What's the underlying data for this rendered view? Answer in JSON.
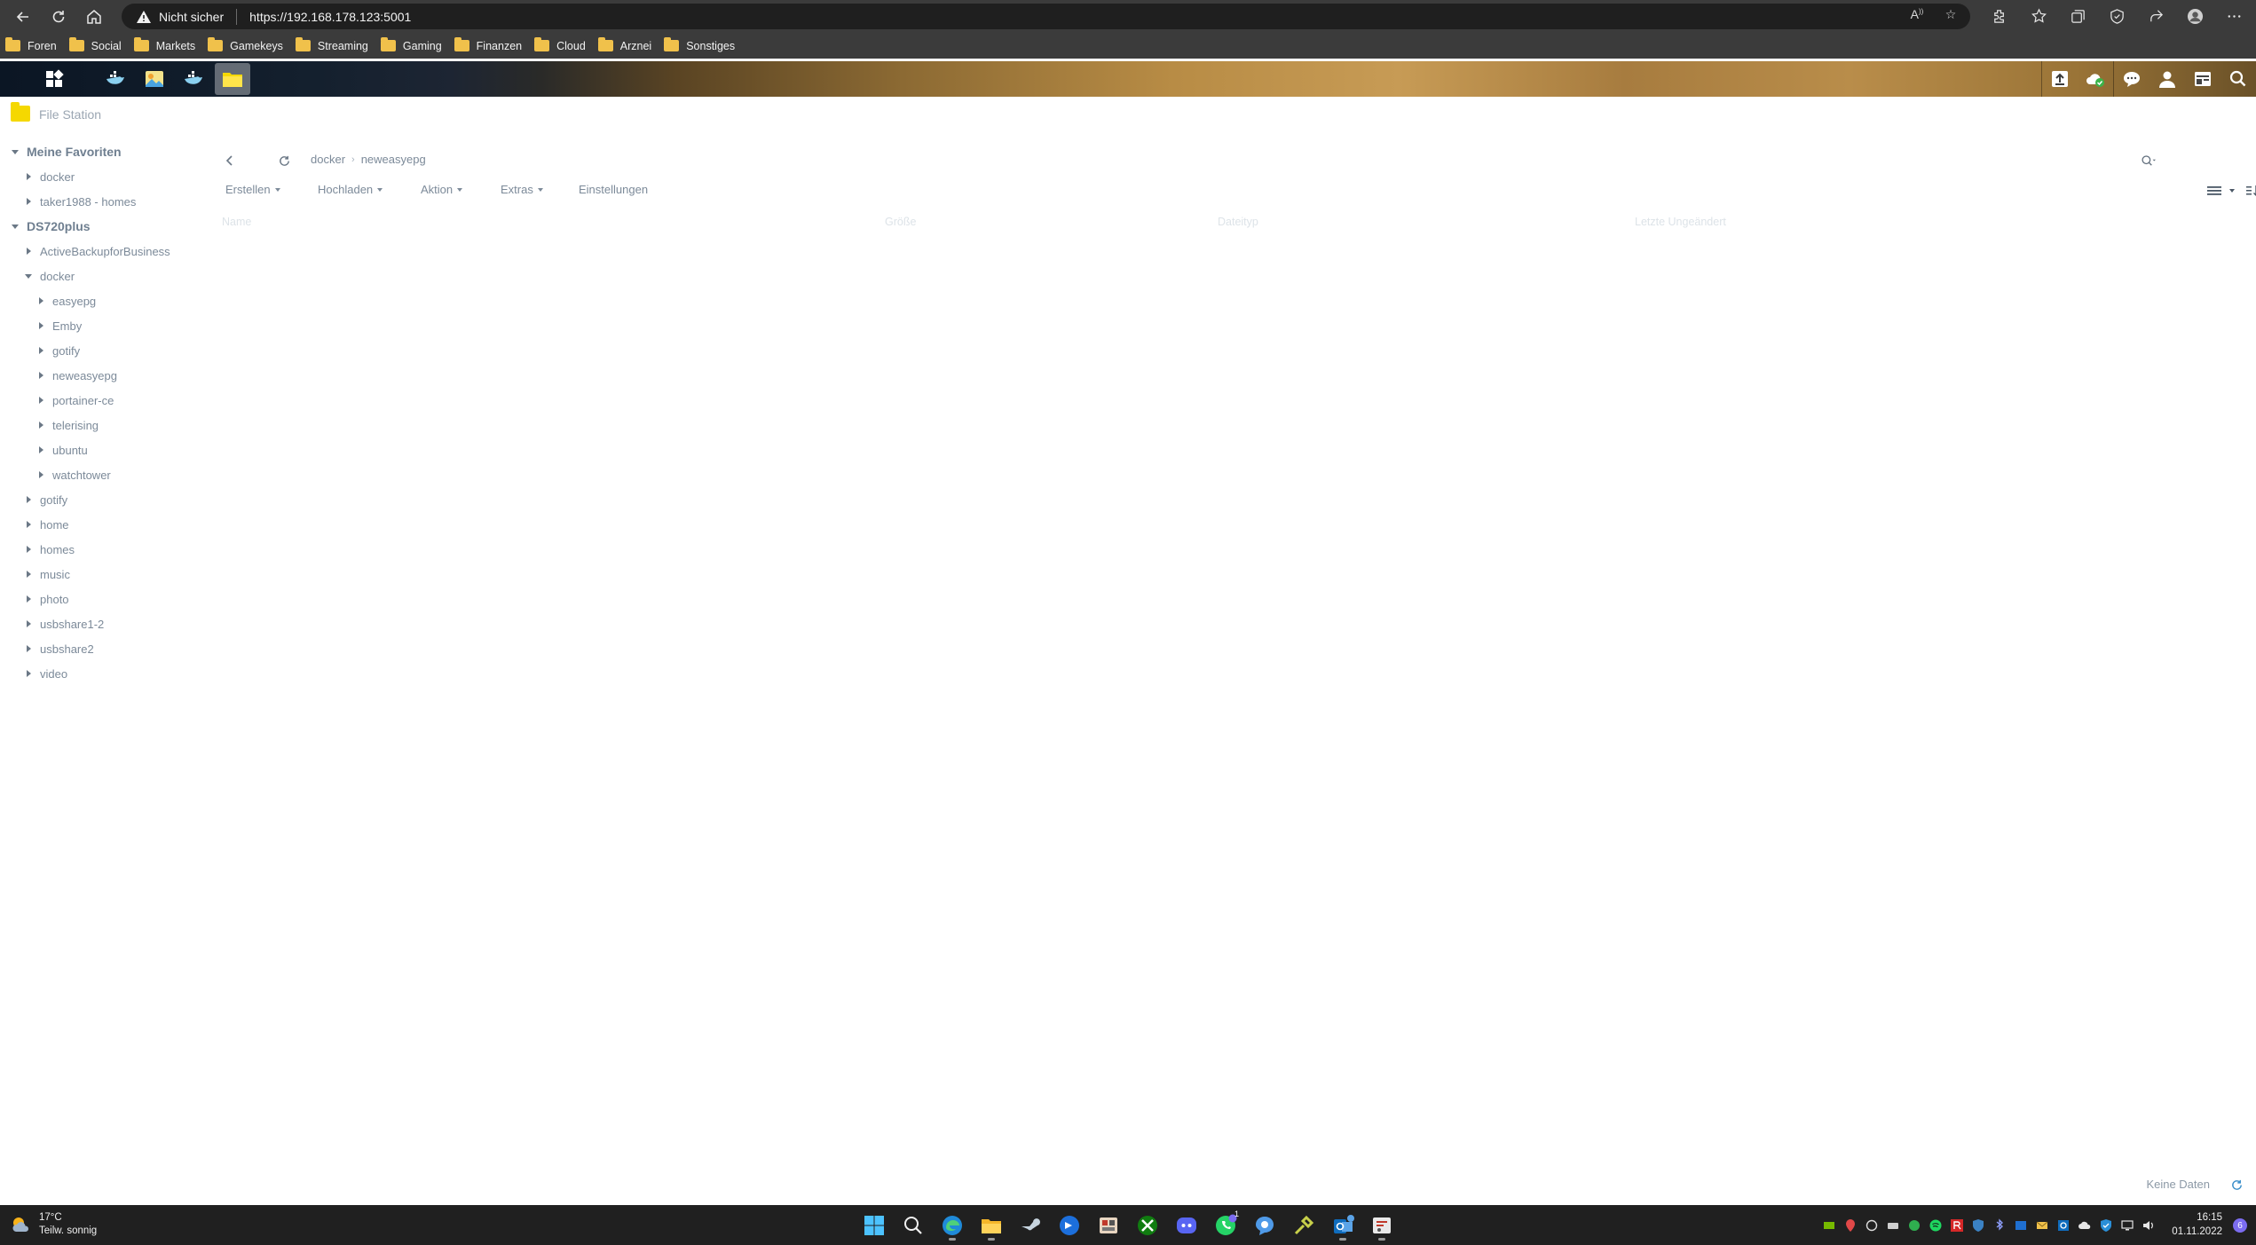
{
  "browser": {
    "security_label": "Nicht sicher",
    "url": "https://192.168.178.123:5001",
    "bookmarks": [
      "Foren",
      "Social",
      "Markets",
      "Gamekeys",
      "Streaming",
      "Gaming",
      "Finanzen",
      "Cloud",
      "Arznei",
      "Sonstiges"
    ]
  },
  "colors": {
    "browser_chrome": "#3b3b3b",
    "address_bar": "#1f1f1f",
    "folder_yellow": "#f0c14b",
    "fs_folder": "#f5d800",
    "sidebar_text": "#7c8a99",
    "windows_taskbar": "#202020"
  },
  "file_station": {
    "title": "File Station",
    "tree": [
      {
        "label": "Meine Favoriten",
        "level": 0,
        "expanded": true,
        "root": true
      },
      {
        "label": "docker",
        "level": 1,
        "expanded": false
      },
      {
        "label": "taker1988 - homes",
        "level": 1,
        "expanded": false
      },
      {
        "label": "DS720plus",
        "level": 0,
        "expanded": true,
        "root": true
      },
      {
        "label": "ActiveBackupforBusiness",
        "level": 1,
        "expanded": false
      },
      {
        "label": "docker",
        "level": 1,
        "expanded": true
      },
      {
        "label": "easyepg",
        "level": 2,
        "expanded": false
      },
      {
        "label": "Emby",
        "level": 2,
        "expanded": false
      },
      {
        "label": "gotify",
        "level": 2,
        "expanded": false
      },
      {
        "label": "neweasyepg",
        "level": 2,
        "expanded": false
      },
      {
        "label": "portainer-ce",
        "level": 2,
        "expanded": false
      },
      {
        "label": "telerising",
        "level": 2,
        "expanded": false
      },
      {
        "label": "ubuntu",
        "level": 2,
        "expanded": false
      },
      {
        "label": "watchtower",
        "level": 2,
        "expanded": false
      },
      {
        "label": "gotify",
        "level": 1,
        "expanded": false
      },
      {
        "label": "home",
        "level": 1,
        "expanded": false
      },
      {
        "label": "homes",
        "level": 1,
        "expanded": false
      },
      {
        "label": "music",
        "level": 1,
        "expanded": false
      },
      {
        "label": "photo",
        "level": 1,
        "expanded": false
      },
      {
        "label": "usbshare1-2",
        "level": 1,
        "expanded": false
      },
      {
        "label": "usbshare2",
        "level": 1,
        "expanded": false
      },
      {
        "label": "video",
        "level": 1,
        "expanded": false
      }
    ],
    "path": [
      "docker",
      "neweasyepg"
    ],
    "path_separator": "›",
    "toolbar": {
      "create": "Erstellen",
      "upload": "Hochladen",
      "action": "Aktion",
      "extras": "Extras",
      "settings": "Einstellungen"
    },
    "columns": [
      "Name",
      "Größe",
      "Dateityp",
      "Letzte Ungeändert"
    ],
    "status": "Keine Daten"
  },
  "windows": {
    "weather": {
      "temp": "17°C",
      "condition": "Teilw. sonnig"
    },
    "clock": {
      "time": "16:15",
      "date": "01.11.2022"
    },
    "whatsapp_badge": "1",
    "notifications": "6"
  }
}
